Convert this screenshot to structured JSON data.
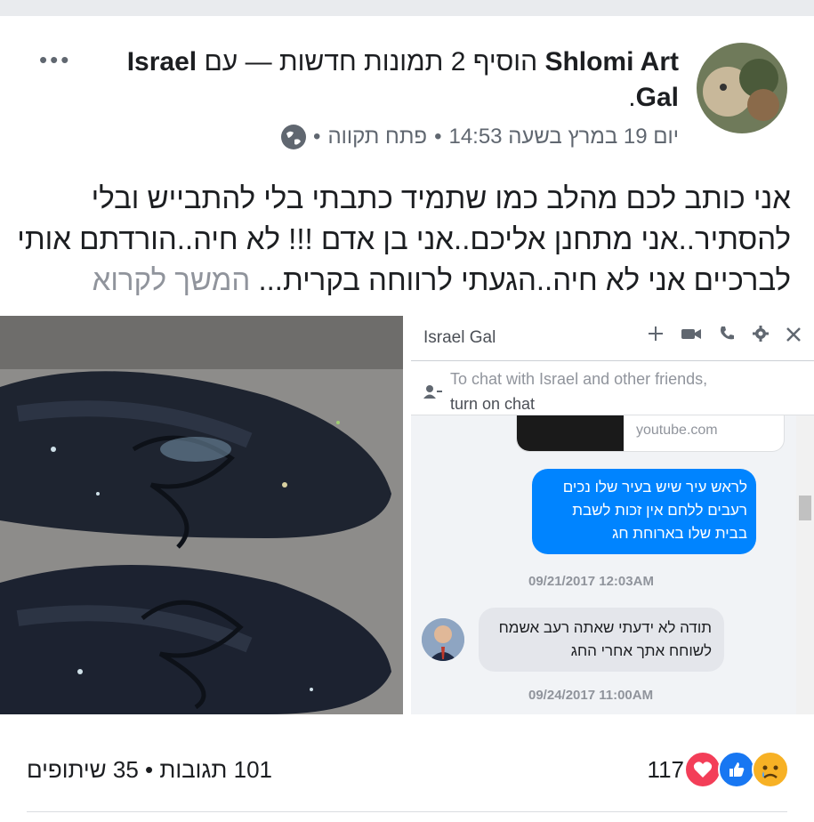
{
  "post": {
    "author": "Shlomi Art",
    "action_text": "הוסיף 2 תמונות חדשות — עם",
    "tagged": "Israel Gal",
    "period": ".",
    "meta": {
      "date": "יום 19 במרץ בשעה 14:53",
      "location": "פתח תקווה",
      "separator": "•"
    },
    "more_label": "•••",
    "body": "אני כותב לכם מהלב כמו שתמיד כתבתי בלי להתבייש ובלי להסתיר..אני מתחנן אליכם..אני בן אדם !!! לא חיה..הורדתם אותי לברכיים אני לא חיה..הגעתי לרווחה בקרית...",
    "see_more": "המשך לקרוא"
  },
  "chat": {
    "name": "Israel Gal",
    "icons": [
      "plus-icon",
      "video-icon",
      "phone-icon",
      "gear-icon",
      "close-icon"
    ],
    "notice_line1": "To chat with Israel and other friends,",
    "notice_link": "turn on chat",
    "link_domain": "youtube.com",
    "messages": [
      {
        "direction": "out",
        "text": "לראש עיר שיש בעיר שלו נכים רעבים ללחם אין זכות לשבת בבית שלו בארוחת חג"
      },
      {
        "direction": "in",
        "text": "תודה לא ידעתי שאתה רעב אשמח לשוחח אתך אחרי החג"
      }
    ],
    "timestamps": [
      "09/21/2017 12:03AM",
      "09/24/2017 11:00AM"
    ]
  },
  "footer": {
    "reactions_count": "117",
    "comments": "101 תגובות",
    "shares": "35 שיתופים",
    "separator": "•"
  },
  "colors": {
    "messenger_blue": "#0084ff",
    "like_blue": "#1877f2",
    "love_red": "#f33e58",
    "sad_yellow": "#f7b125"
  }
}
